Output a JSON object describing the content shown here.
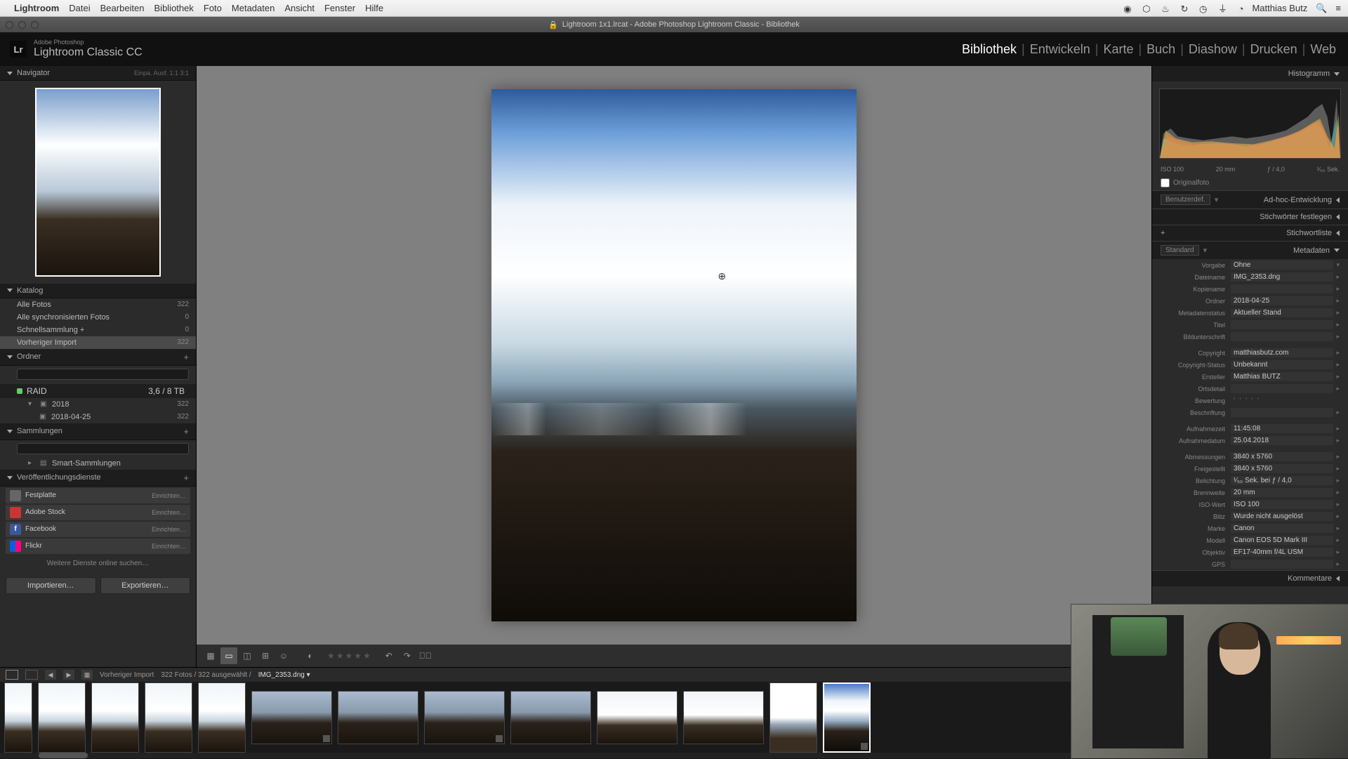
{
  "mac_menu": {
    "app": "Lightroom",
    "items": [
      "Datei",
      "Bearbeiten",
      "Bibliothek",
      "Foto",
      "Metadaten",
      "Ansicht",
      "Fenster",
      "Hilfe"
    ],
    "user": "Matthias Butz"
  },
  "window": {
    "title": "Lightroom 1x1.lrcat - Adobe Photoshop Lightroom Classic - Bibliothek"
  },
  "identity": {
    "sub": "Adobe Photoshop",
    "main": "Lightroom Classic CC",
    "logo": "Lr"
  },
  "modules": [
    "Bibliothek",
    "Entwickeln",
    "Karte",
    "Buch",
    "Diashow",
    "Drucken",
    "Web"
  ],
  "active_module": "Bibliothek",
  "left": {
    "navigator": {
      "title": "Navigator",
      "opts": "Einpa.   Ausf.   1:1   3:1"
    },
    "catalog": {
      "title": "Katalog",
      "items": [
        {
          "label": "Alle Fotos",
          "count": "322"
        },
        {
          "label": "Alle synchronisierten Fotos",
          "count": "0"
        },
        {
          "label": "Schnellsammlung  +",
          "count": "0"
        },
        {
          "label": "Vorheriger Import",
          "count": "322",
          "sel": true
        }
      ]
    },
    "folders": {
      "title": "Ordner",
      "volume": {
        "name": "RAID",
        "info": "3,6 / 8 TB"
      },
      "tree": [
        {
          "label": "2018",
          "count": "322",
          "lvl": 1
        },
        {
          "label": "2018-04-25",
          "count": "322",
          "lvl": 2
        }
      ]
    },
    "collections": {
      "title": "Sammlungen",
      "smart": "Smart-Sammlungen"
    },
    "publish": {
      "title": "Veröffentlichungsdienste",
      "setup": "Einrichten…",
      "items": [
        {
          "name": "Festplatte",
          "color": "#666"
        },
        {
          "name": "Adobe Stock",
          "color": "#c33"
        },
        {
          "name": "Facebook",
          "color": "#3b5998"
        },
        {
          "name": "Flickr",
          "color": "#ff0084"
        }
      ],
      "find": "Weitere Dienste online suchen…"
    },
    "import": "Importieren…",
    "export": "Exportieren…"
  },
  "right": {
    "histogram": {
      "title": "Histogramm",
      "iso": "ISO 100",
      "focal": "20 mm",
      "aperture": "ƒ / 4,0",
      "shutter": "¹⁄₆₀ Sek."
    },
    "original": "Originalfoto",
    "none_sel": "Benutzerdef.",
    "quickdev": "Ad-hoc-Entwicklung",
    "keywording": "Stichwörter festlegen",
    "keywordlist": "Stichwortliste",
    "metadata": {
      "title": "Metadaten",
      "preset": "Standard"
    },
    "comments": "Kommentare",
    "preset_label": "Vorgabe",
    "preset_value": "Ohne",
    "fields": [
      {
        "lbl": "Dateiname",
        "val": "IMG_2353.dng"
      },
      {
        "lbl": "Kopiename",
        "val": ""
      },
      {
        "lbl": "Ordner",
        "val": "2018-04-25"
      },
      {
        "lbl": "Metadatenstatus",
        "val": "Aktueller Stand"
      },
      {
        "lbl": "Titel",
        "val": ""
      },
      {
        "lbl": "Bildunterschrift",
        "val": ""
      },
      {
        "lbl": "",
        "val": ""
      },
      {
        "lbl": "Copyright",
        "val": "matthiasbutz.com"
      },
      {
        "lbl": "Copyright-Status",
        "val": "Unbekannt"
      },
      {
        "lbl": "Ersteller",
        "val": "Matthias BUTZ"
      },
      {
        "lbl": "Ortsdetail",
        "val": ""
      },
      {
        "lbl": "Bewertung",
        "val": "rating"
      },
      {
        "lbl": "Beschriftung",
        "val": ""
      },
      {
        "lbl": "",
        "val": ""
      },
      {
        "lbl": "Aufnahmezeit",
        "val": "11:45:08"
      },
      {
        "lbl": "Aufnahmedatum",
        "val": "25.04.2018"
      },
      {
        "lbl": "",
        "val": ""
      },
      {
        "lbl": "Abmessungen",
        "val": "3840 x 5760"
      },
      {
        "lbl": "Freigestellt",
        "val": "3840 x 5760"
      },
      {
        "lbl": "Belichtung",
        "val": "¹⁄₆₀ Sek. bei ƒ / 4,0"
      },
      {
        "lbl": "Brennweite",
        "val": "20 mm"
      },
      {
        "lbl": "ISO-Wert",
        "val": "ISO 100"
      },
      {
        "lbl": "Blitz",
        "val": "Wurde nicht ausgelöst"
      },
      {
        "lbl": "Marke",
        "val": "Canon"
      },
      {
        "lbl": "Modell",
        "val": "Canon EOS 5D Mark III"
      },
      {
        "lbl": "Objektiv",
        "val": "EF17-40mm f/4L USM"
      },
      {
        "lbl": "GPS",
        "val": ""
      }
    ]
  },
  "filmstrip": {
    "crumb": "Vorheriger Import",
    "stats": "322 Fotos / 322 ausgewählt /",
    "file": "IMG_2353.dng ▾"
  }
}
